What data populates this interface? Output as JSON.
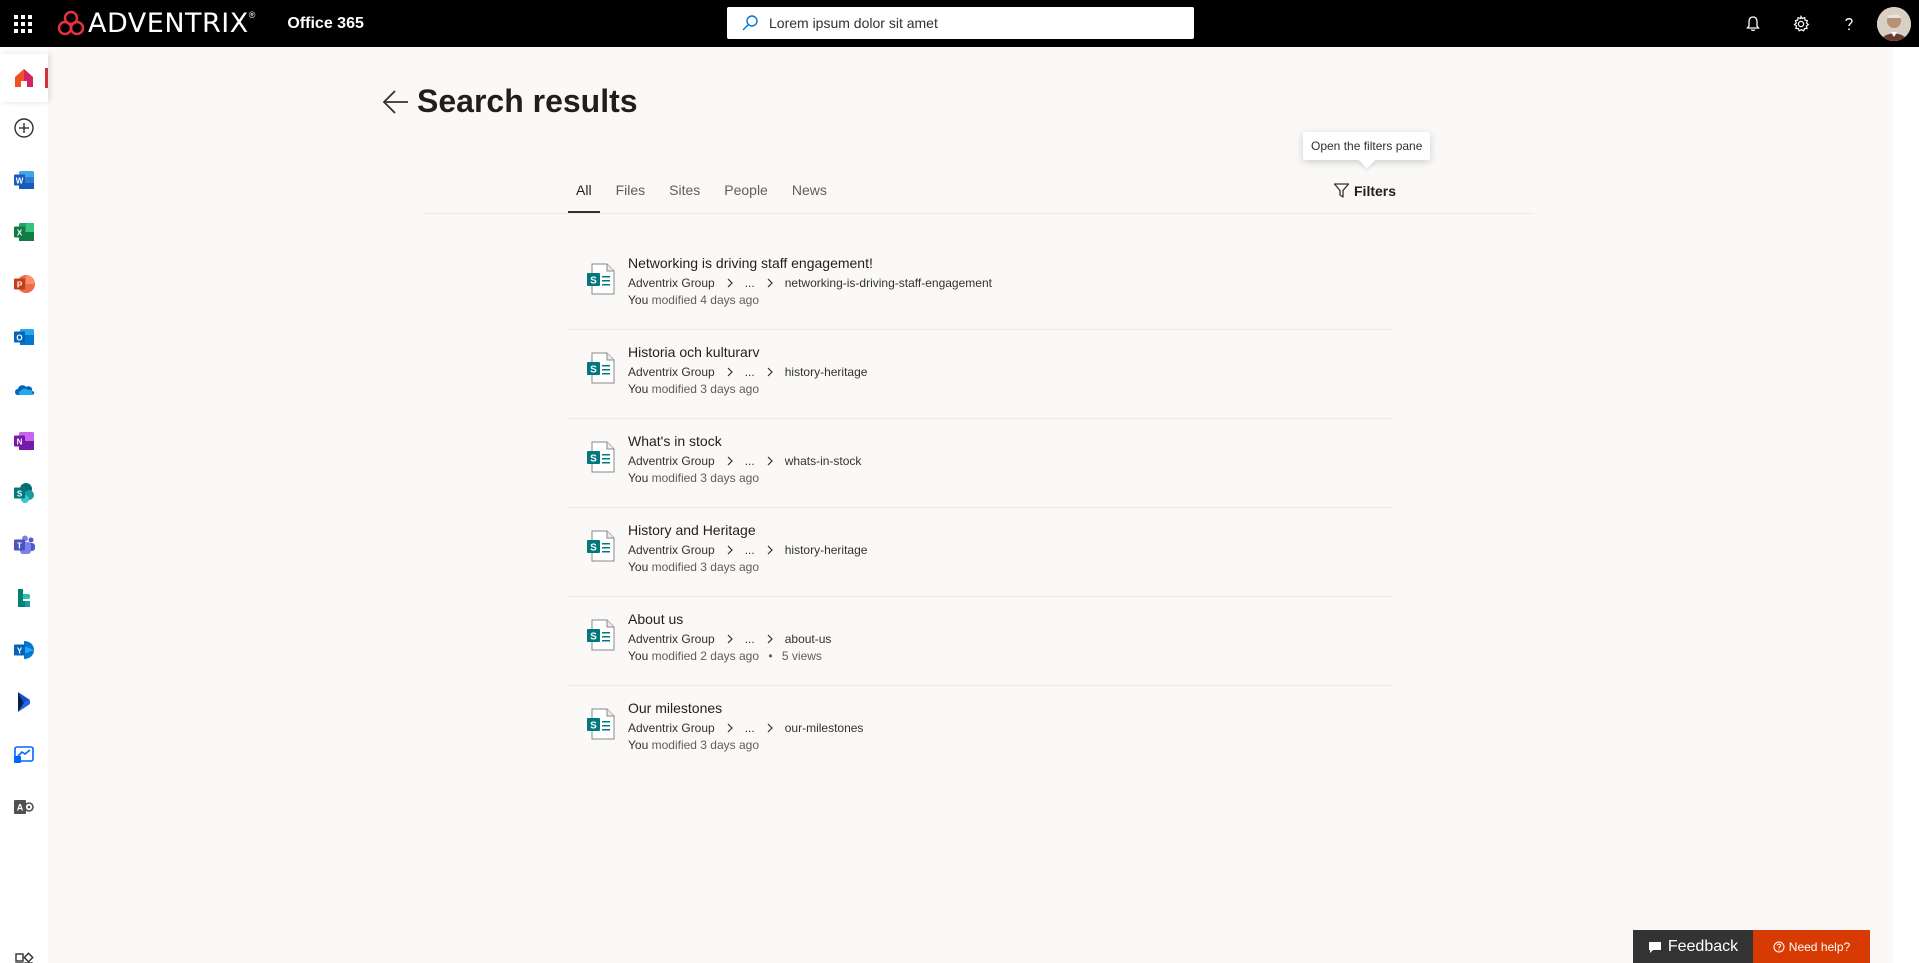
{
  "header": {
    "brand_name": "ADVENTRIX",
    "brand_reg": "®",
    "app_name": "Office 365",
    "search_value": "Lorem ipsum dolor sit amet"
  },
  "page": {
    "title": "Search results",
    "tabs": [
      "All",
      "Files",
      "Sites",
      "People",
      "News"
    ],
    "filters_label": "Filters",
    "filters_tooltip": "Open the filters pane"
  },
  "results": [
    {
      "title": "Networking is driving staff engagement!",
      "site": "Adventrix Group",
      "ellipsis": "...",
      "page": "networking-is-driving-staff-engagement",
      "modified_by": "You",
      "modified": "modified 4 days ago",
      "views": ""
    },
    {
      "title": "Historia och kulturarv",
      "site": "Adventrix Group",
      "ellipsis": "...",
      "page": "history-heritage",
      "modified_by": "You",
      "modified": "modified 3 days ago",
      "views": ""
    },
    {
      "title": "What's in stock",
      "site": "Adventrix Group",
      "ellipsis": "...",
      "page": "whats-in-stock",
      "modified_by": "You",
      "modified": "modified 3 days ago",
      "views": ""
    },
    {
      "title": "History and Heritage",
      "site": "Adventrix Group",
      "ellipsis": "...",
      "page": "history-heritage",
      "modified_by": "You",
      "modified": "modified 3 days ago",
      "views": ""
    },
    {
      "title": "About us",
      "site": "Adventrix Group",
      "ellipsis": "...",
      "page": "about-us",
      "modified_by": "You",
      "modified": "modified 2 days ago",
      "views": "5 views"
    },
    {
      "title": "Our milestones",
      "site": "Adventrix Group",
      "ellipsis": "...",
      "page": "our-milestones",
      "modified_by": "You",
      "modified": "modified 3 days ago",
      "views": ""
    }
  ],
  "footer": {
    "feedback_label": "Feedback",
    "help_label": "Need help?"
  },
  "rail_icons": [
    "home-icon",
    "create-icon",
    "word-icon",
    "excel-icon",
    "powerpoint-icon",
    "outlook-icon",
    "onedrive-icon",
    "onenote-icon",
    "sharepoint-icon",
    "teams-icon",
    "sway-icon",
    "yammer-icon",
    "dynamics-icon",
    "power-automate-icon",
    "admin-icon",
    "all-apps-icon"
  ],
  "colors": {
    "accent": "#d13438",
    "sharepoint": "#03787c",
    "help": "#d83b01"
  }
}
